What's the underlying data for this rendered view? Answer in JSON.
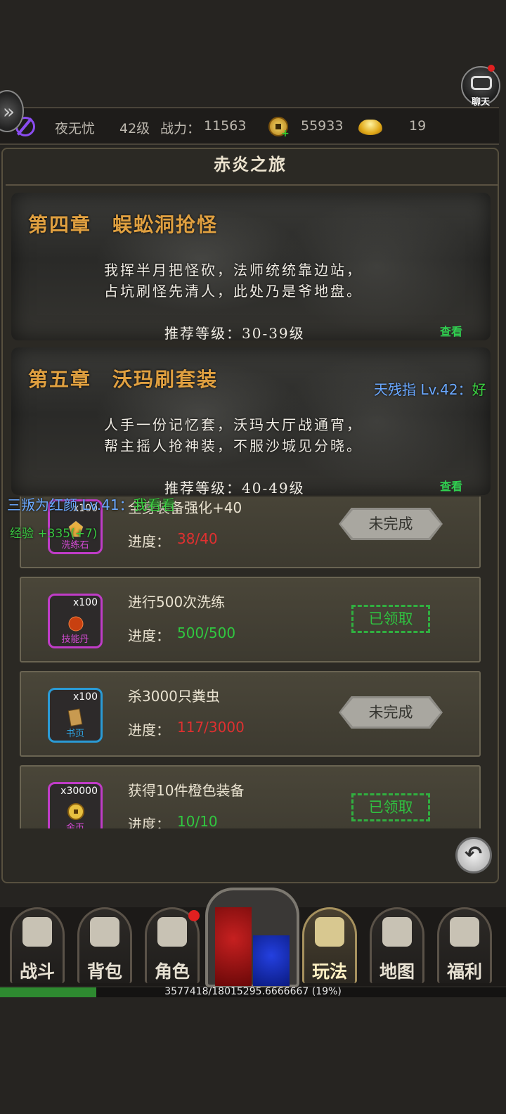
{
  "chat": {
    "label": "聊天"
  },
  "player": {
    "name": "夜无忧",
    "level": "42级",
    "power_label": "战力：",
    "power": "11563",
    "coins": "55933",
    "ingots": "19"
  },
  "panel": {
    "title": "赤炎之旅"
  },
  "chapters": [
    {
      "title": "第四章　蜈蚣洞抢怪",
      "line1": "我挥半月把怪砍，法师统统靠边站，",
      "line2": "占坑刷怪先清人，此处乃是爷地盘。",
      "level": "推荐等级：30-39级",
      "view": "查看"
    },
    {
      "title": "第五章　沃玛刷套装",
      "line1": "人手一份记忆套，沃玛大厅战通宵，",
      "line2": "帮主摇人抢神装，不服沙城见分晓。",
      "level": "推荐等级：40-49级",
      "view": "查看"
    }
  ],
  "floating": {
    "msg1_name": "天残指 Lv.42：",
    "msg1_text": "好",
    "msg2_name": "三叛为红颜 Lv.41：",
    "msg2_text": "我看看",
    "exp_gain": "经验 +335(+7)"
  },
  "quests": [
    {
      "qty": "x100",
      "item": "洗练石",
      "task": "全身装备强化+40",
      "progress_label": "进度：",
      "progress": "38/40",
      "status": "未完成",
      "done": false,
      "color": "purple"
    },
    {
      "qty": "x100",
      "item": "技能丹",
      "task": "进行500次洗练",
      "progress_label": "进度：",
      "progress": "500/500",
      "status": "已领取",
      "done": true,
      "color": "purple"
    },
    {
      "qty": "x100",
      "item": "书页",
      "task": "杀3000只粪虫",
      "progress_label": "进度：",
      "progress": "117/3000",
      "status": "未完成",
      "done": false,
      "color": "blue"
    },
    {
      "qty": "x30000",
      "item": "金币",
      "task": "获得10件橙色装备",
      "progress_label": "进度：",
      "progress": "10/10",
      "status": "已领取",
      "done": true,
      "color": "purple"
    }
  ],
  "nav": [
    {
      "label": "战斗",
      "icon": "crossed-swords-icon"
    },
    {
      "label": "背包",
      "icon": "backpack-icon"
    },
    {
      "label": "角色",
      "icon": "helmet-icon"
    },
    {
      "label": "玩法",
      "icon": "sword-slash-icon",
      "active": true
    },
    {
      "label": "地图",
      "icon": "map-icon"
    },
    {
      "label": "福利",
      "icon": "treasure-chest-icon"
    }
  ],
  "exp": {
    "text": "3577418/18015295.6666667 (19%)",
    "fraction": 0.19
  },
  "colors": {
    "accent_gold": "#e0a040",
    "progress_red": "#e03030",
    "progress_green": "#30c840",
    "view_green": "#30d050"
  }
}
